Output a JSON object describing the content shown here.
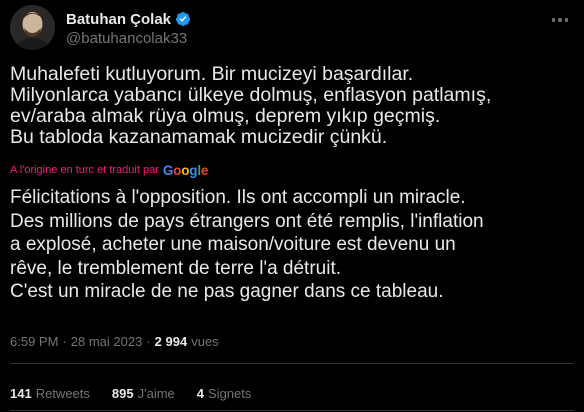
{
  "author": {
    "display_name": "Batuhan Çolak",
    "handle": "@batuhancolak33",
    "verified_color": "#1d9bf0"
  },
  "tweet": {
    "original_text": "Muhalefeti kutluyorum. Bir mucizeyi başardılar.\nMilyonlarca yabancı ülkeye dolmuş, enflasyon patlamış,\nev/araba almak rüya olmuş, deprem yıkıp geçmiş.\nBu tabloda kazanamamak mucizedir çünkü.",
    "translation_label": "A l'origine en turc et traduit par",
    "translation_provider": "Google",
    "translated_text": "Félicitations à l'opposition. Ils ont accompli un miracle.\nDes millions de pays étrangers ont été remplis, l'inflation\na explosé, acheter une maison/voiture est devenu un\nrêve, le tremblement de terre l'a détruit.\nC'est un miracle de ne pas gagner dans ce tableau."
  },
  "meta": {
    "time": "6:59 PM",
    "separator1": "·",
    "date": "28 mai 2023",
    "separator2": "·",
    "views_count": "2 994",
    "views_label": "vues"
  },
  "stats": {
    "retweets_count": "141",
    "retweets_label": "Retweets",
    "likes_count": "895",
    "likes_label": "J'aime",
    "bookmarks_count": "4",
    "bookmarks_label": "Signets"
  },
  "colors": {
    "background": "#000000",
    "primary_text": "#e7e9ea",
    "secondary_text": "#71767b",
    "translation_label": "#f91880",
    "divider": "#2f3336"
  },
  "icons": {
    "verified": "verified-badge-icon",
    "more": "more-options-icon"
  }
}
